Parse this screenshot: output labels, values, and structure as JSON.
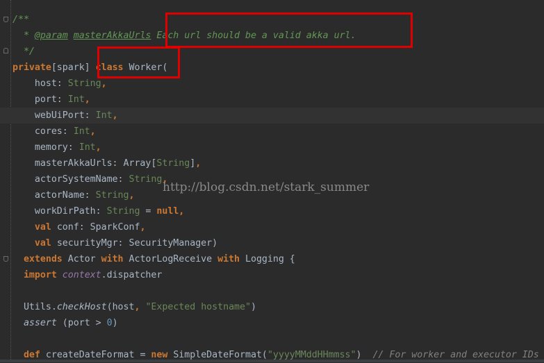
{
  "editor": {
    "current_line": 6,
    "colors": {
      "background": "#2b2b2b",
      "keyword": "#cc7832",
      "string": "#6a8759",
      "number": "#6897bb",
      "doc_comment": "#629755",
      "text": "#a9b7c6",
      "highlight_box": "#e00000"
    },
    "lines": [
      [
        [
          "/**",
          "doc"
        ]
      ],
      [
        [
          "  * ",
          "doc"
        ],
        [
          "@param",
          "doctag"
        ],
        [
          " ",
          "doc"
        ],
        [
          "masterAkkaUrls",
          "doctag"
        ],
        [
          " Each url should be a valid akka url.",
          "doc"
        ]
      ],
      [
        [
          "  */",
          "doc"
        ]
      ],
      [
        [
          "private",
          "kw"
        ],
        [
          "[spark] ",
          ""
        ],
        [
          "class",
          "kw"
        ],
        [
          " Worker(",
          ""
        ]
      ],
      [
        [
          "    host: ",
          ""
        ],
        [
          "String",
          "str"
        ],
        [
          ",",
          "kw"
        ]
      ],
      [
        [
          "    port: ",
          ""
        ],
        [
          "Int",
          "str"
        ],
        [
          ",",
          "kw"
        ]
      ],
      [
        [
          "    webUiPort: ",
          ""
        ],
        [
          "Int",
          "str"
        ],
        [
          ",",
          "kw"
        ]
      ],
      [
        [
          "    cores: ",
          ""
        ],
        [
          "Int",
          "str"
        ],
        [
          ",",
          "kw"
        ]
      ],
      [
        [
          "    memory: ",
          ""
        ],
        [
          "Int",
          "str"
        ],
        [
          ",",
          "kw"
        ]
      ],
      [
        [
          "    masterAkkaUrls: Array[",
          ""
        ],
        [
          "String",
          "str"
        ],
        [
          "]",
          ""
        ],
        [
          ",",
          "kw"
        ]
      ],
      [
        [
          "    actorSystemName: ",
          ""
        ],
        [
          "String",
          "str"
        ],
        [
          ",",
          "kw"
        ]
      ],
      [
        [
          "    actorName: ",
          ""
        ],
        [
          "String",
          "str"
        ],
        [
          ",",
          "kw"
        ]
      ],
      [
        [
          "    workDirPath: ",
          ""
        ],
        [
          "String",
          "str"
        ],
        [
          " = ",
          ""
        ],
        [
          "null",
          "kw"
        ],
        [
          ",",
          "kw"
        ]
      ],
      [
        [
          "    ",
          ""
        ],
        [
          "val",
          "kw"
        ],
        [
          " conf: SparkConf",
          ""
        ],
        [
          ",",
          "kw"
        ]
      ],
      [
        [
          "    ",
          ""
        ],
        [
          "val",
          "kw"
        ],
        [
          " securityMgr: SecurityManager)",
          ""
        ]
      ],
      [
        [
          "  ",
          ""
        ],
        [
          "extends",
          "kw"
        ],
        [
          " Actor ",
          ""
        ],
        [
          "with",
          "kw"
        ],
        [
          " ActorLogReceive ",
          ""
        ],
        [
          "with",
          "kw"
        ],
        [
          " Logging {",
          ""
        ]
      ],
      [
        [
          "  ",
          ""
        ],
        [
          "import",
          "kw"
        ],
        [
          " ",
          ""
        ],
        [
          "context",
          "pl"
        ],
        [
          ".dispatcher",
          ""
        ]
      ],
      [],
      [
        [
          "  Utils.",
          ""
        ],
        [
          "checkHost",
          "it"
        ],
        [
          "(host",
          ""
        ],
        [
          ", ",
          "kw"
        ],
        [
          "\"Expected hostname\"",
          "str"
        ],
        [
          ")",
          ""
        ]
      ],
      [
        [
          "  ",
          ""
        ],
        [
          "assert",
          "it"
        ],
        [
          " (port > ",
          ""
        ],
        [
          "0",
          "num"
        ],
        [
          ")",
          ""
        ]
      ],
      [],
      [
        [
          "  ",
          ""
        ],
        [
          "def",
          "kw"
        ],
        [
          " createDateFormat = ",
          ""
        ],
        [
          "new",
          "kw"
        ],
        [
          " SimpleDateFormat(",
          ""
        ],
        [
          "\"yyyyMMddHHmmss\"",
          "str"
        ],
        [
          ")  ",
          ""
        ],
        [
          "// For worker and executor IDs",
          "lc"
        ]
      ]
    ]
  },
  "watermark": "http://blog.csdn.net/stark_summer"
}
